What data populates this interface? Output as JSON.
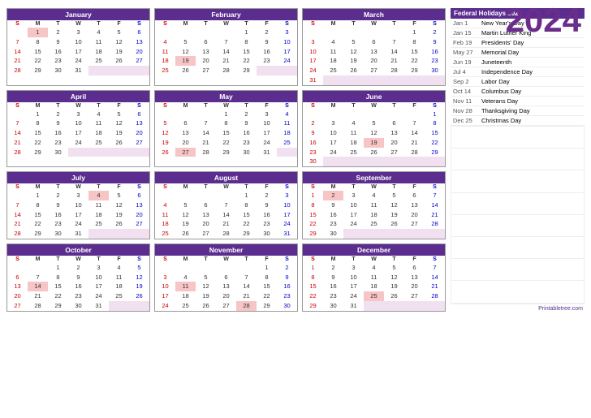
{
  "title": "2024",
  "months": [
    {
      "name": "January",
      "startDay": 1,
      "days": 31,
      "holidays": [
        1
      ]
    },
    {
      "name": "February",
      "startDay": 4,
      "days": 29,
      "holidays": [
        19
      ]
    },
    {
      "name": "March",
      "startDay": 5,
      "days": 31,
      "holidays": []
    },
    {
      "name": "April",
      "startDay": 1,
      "days": 30,
      "holidays": []
    },
    {
      "name": "May",
      "startDay": 3,
      "days": 31,
      "holidays": [
        27
      ]
    },
    {
      "name": "June",
      "startDay": 6,
      "days": 30,
      "holidays": [
        19
      ]
    },
    {
      "name": "July",
      "startDay": 1,
      "days": 31,
      "holidays": [
        4
      ]
    },
    {
      "name": "August",
      "startDay": 4,
      "days": 31,
      "holidays": []
    },
    {
      "name": "September",
      "startDay": 0,
      "days": 30,
      "holidays": [
        2
      ]
    },
    {
      "name": "October",
      "startDay": 2,
      "days": 31,
      "holidays": [
        14
      ]
    },
    {
      "name": "November",
      "startDay": 5,
      "days": 30,
      "holidays": [
        11,
        28
      ]
    },
    {
      "name": "December",
      "startDay": 0,
      "days": 31,
      "holidays": [
        25
      ]
    }
  ],
  "dayHeaders": [
    "S",
    "M",
    "T",
    "W",
    "T",
    "F",
    "S"
  ],
  "federalHolidays": {
    "title": "Federal Holidays 2024",
    "items": [
      {
        "date": "Jan 1",
        "name": "New Year's Day"
      },
      {
        "date": "Jan 15",
        "name": "Martin Luther King"
      },
      {
        "date": "Feb 19",
        "name": "Presidents' Day"
      },
      {
        "date": "May 27",
        "name": "Memorial Day"
      },
      {
        "date": "Jun 19",
        "name": "Juneteenth"
      },
      {
        "date": "Jul 4",
        "name": "Independence Day"
      },
      {
        "date": "Sep 2",
        "name": "Labor Day"
      },
      {
        "date": "Oct 14",
        "name": "Columbus Day"
      },
      {
        "date": "Nov 11",
        "name": "Veterans Day"
      },
      {
        "date": "Nov 28",
        "name": "Thanksgiving Day"
      },
      {
        "date": "Dec 25",
        "name": "Christmas Day"
      }
    ]
  },
  "footer": "Printabletree.com"
}
